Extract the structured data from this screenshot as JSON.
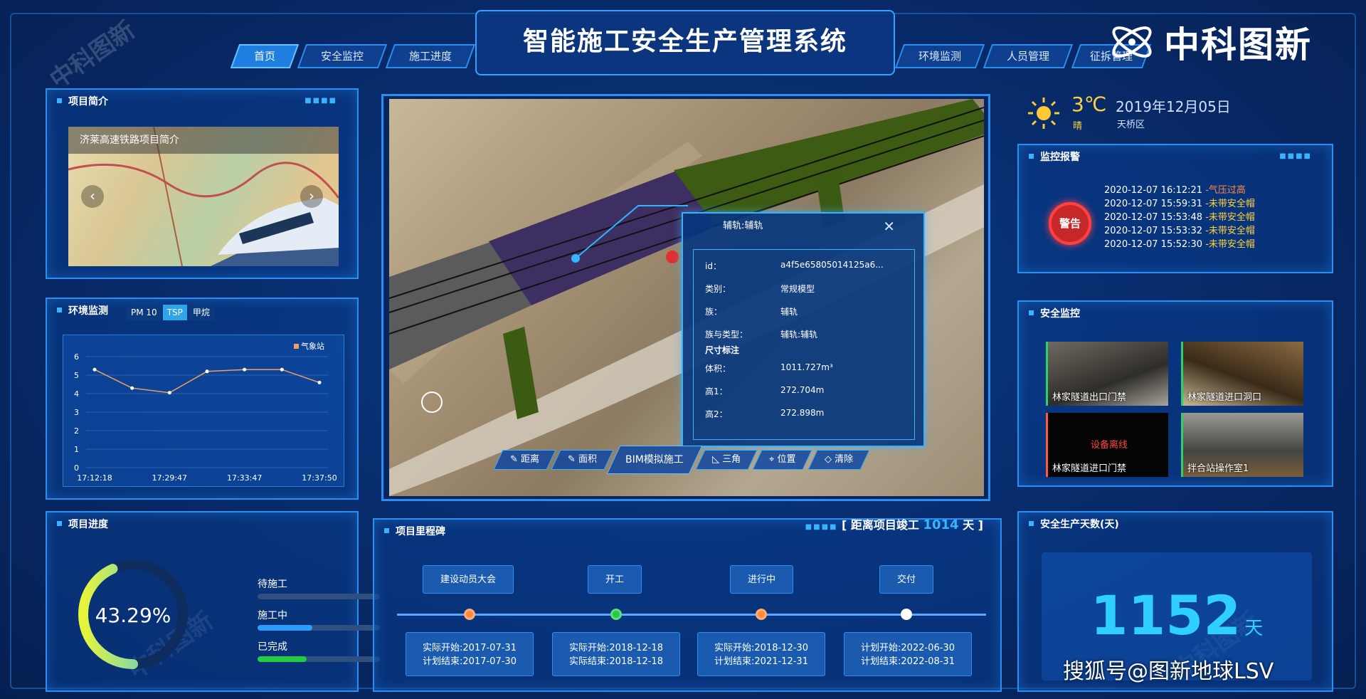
{
  "app": {
    "title": "智能施工安全生产管理系统",
    "logo_text": "中科图新",
    "watermark": "中科图新",
    "footer_watermark": "搜狐号@图新地球LSV"
  },
  "nav_left": [
    {
      "label": "首页",
      "active": true
    },
    {
      "label": "安全监控"
    },
    {
      "label": "施工进度"
    }
  ],
  "nav_right": [
    {
      "label": "环境监测"
    },
    {
      "label": "人员管理"
    },
    {
      "label": "征拆管理"
    }
  ],
  "weather": {
    "temp": "3℃",
    "condition": "晴",
    "date": "2019年12月05日",
    "district": "天桥区",
    "icon": "sun-icon"
  },
  "project_intro": {
    "title": "项目简介",
    "caption": "济莱高速铁路项目简介"
  },
  "env": {
    "title": "环境监测",
    "tabs": [
      {
        "label": "PM 10"
      },
      {
        "label": "TSP",
        "active": true
      },
      {
        "label": "甲烷"
      }
    ]
  },
  "chart_data": {
    "type": "line",
    "categories": [
      "17:12:18",
      "",
      "17:29:47",
      "",
      "17:33:47",
      "",
      "17:37:50"
    ],
    "series": [
      {
        "name": "气象站",
        "values": [
          5.3,
          4.3,
          4.05,
          5.2,
          5.3,
          5.3,
          4.6
        ],
        "color": "#f0a060"
      }
    ],
    "x_tick_labels": [
      "17:12:18",
      "17:29:47",
      "17:33:47",
      "17:37:50"
    ],
    "y_ticks": [
      0,
      1,
      2,
      3,
      4,
      5,
      6
    ],
    "ylim": [
      0,
      6
    ],
    "grid": true,
    "legend": "top-right"
  },
  "progress": {
    "title": "项目进度",
    "percent": "43.29%",
    "percent_value": 43.29,
    "rows": [
      {
        "label": "待施工",
        "fraction": 0.0,
        "color": "#4a6aa0"
      },
      {
        "label": "施工中",
        "fraction": 0.45,
        "color": "#2f9bff"
      },
      {
        "label": "已完成",
        "fraction": 0.4,
        "color": "#22cc44"
      }
    ]
  },
  "milestone": {
    "title": "项目里程碑",
    "countdown_prefix": "[ 距离项目竣工",
    "countdown_days": "1014",
    "countdown_suffix": "天 ]",
    "stages": [
      {
        "label": "建设动员大会",
        "l1": "实际开始:2017-07-31",
        "l2": "计划结束:2017-07-30",
        "dot": "#ff8a3c"
      },
      {
        "label": "开工",
        "l1": "实际开始:2018-12-18",
        "l2": "实际结束:2018-12-18",
        "dot": "#22cc44"
      },
      {
        "label": "进行中",
        "l1": "实际开始:2018-12-30",
        "l2": "计划结束:2021-12-31",
        "dot": "#ff8a3c"
      },
      {
        "label": "交付",
        "l1": "计划开始:2022-06-30",
        "l2": "计划结束:2022-08-31",
        "dot": "#ffffff"
      }
    ]
  },
  "alarm": {
    "title": "监控报警",
    "badge": "警告",
    "rows": [
      {
        "time": "2020-12-07 16:12:21",
        "msg": "-气压过高",
        "red": true
      },
      {
        "time": "2020-12-07 15:59:31",
        "msg": "-未带安全帽"
      },
      {
        "time": "2020-12-07 15:53:48",
        "msg": "-未带安全帽"
      },
      {
        "time": "2020-12-07 15:53:32",
        "msg": "-未带安全帽"
      },
      {
        "time": "2020-12-07 15:52:30",
        "msg": "-未带安全帽"
      }
    ]
  },
  "safety_monitor": {
    "title": "安全监控",
    "cams": [
      {
        "label": "林家隧道出口门禁"
      },
      {
        "label": "林家隧道进口洞口"
      },
      {
        "label": "林家隧道进口门禁",
        "offline": "设备离线"
      },
      {
        "label": "拌合站操作室1"
      }
    ]
  },
  "safe_days": {
    "title": "安全生产天数(天)",
    "value": "1152",
    "unit": "天"
  },
  "popup": {
    "title": "辅轨:辅轨",
    "rows": [
      {
        "k": "id：",
        "v": "a4f5e65805014125a6..."
      },
      {
        "k": "类别：",
        "v": "常规模型"
      },
      {
        "k": "族：",
        "v": "辅轨"
      },
      {
        "k": "族与类型：",
        "v": "辅轨:辅轨"
      },
      {
        "k": "尺寸标注",
        "v": ""
      },
      {
        "k": "体积：",
        "v": "1011.727m³"
      },
      {
        "k": "高1：",
        "v": "272.704m"
      },
      {
        "k": "高2：",
        "v": "272.898m"
      }
    ]
  },
  "tools": [
    {
      "label": "距离"
    },
    {
      "label": "面积"
    },
    {
      "label": "BIM模拟施工"
    },
    {
      "label": "三角"
    },
    {
      "label": "位置"
    },
    {
      "label": "清除"
    }
  ]
}
